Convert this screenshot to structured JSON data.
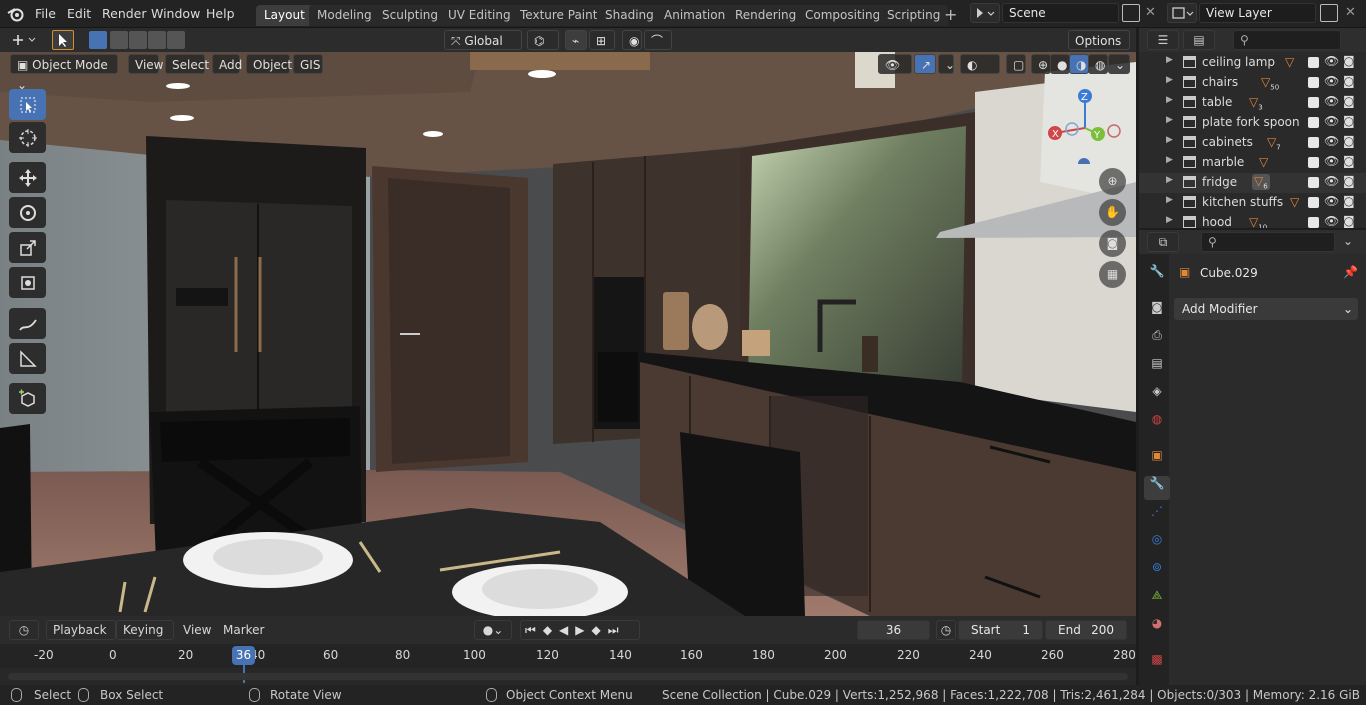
{
  "menus": [
    "File",
    "Edit",
    "Render",
    "Window",
    "Help"
  ],
  "workspaces": [
    "Layout",
    "Modeling",
    "Sculpting",
    "UV Editing",
    "Texture Paint",
    "Shading",
    "Animation",
    "Rendering",
    "Compositing",
    "Scripting"
  ],
  "active_workspace": "Layout",
  "scene_field": "Scene",
  "view_layer_field": "View Layer",
  "transform_orientation": "Global",
  "options_label": "Options",
  "viewport_header": {
    "mode": "Object Mode",
    "items": [
      "View",
      "Select",
      "Add",
      "Object",
      "GIS"
    ]
  },
  "gizmo": {
    "z": "Z",
    "y": "Y",
    "x": "X"
  },
  "outliner": {
    "items": [
      {
        "label": "ceiling lamp",
        "badge": ""
      },
      {
        "label": "chairs",
        "badge": "50"
      },
      {
        "label": "table",
        "badge": "3"
      },
      {
        "label": "plate fork spoon",
        "badge": ""
      },
      {
        "label": "cabinets",
        "badge": "7"
      },
      {
        "label": "marble",
        "badge": ""
      },
      {
        "label": "fridge",
        "badge": "6"
      },
      {
        "label": "kitchen stuffs",
        "badge": ""
      },
      {
        "label": "hood",
        "badge": "10"
      }
    ]
  },
  "properties": {
    "object_name": "Cube.029",
    "add_modifier": "Add Modifier"
  },
  "timeline": {
    "menus": [
      "Playback",
      "Keying",
      "View",
      "Marker"
    ],
    "current_frame": "36",
    "start_label": "Start",
    "start": "1",
    "end_label": "End",
    "end": "200",
    "ticks": [
      "-20",
      "0",
      "20",
      "40",
      "60",
      "80",
      "100",
      "120",
      "140",
      "160",
      "180",
      "200",
      "220",
      "240",
      "260",
      "280"
    ]
  },
  "statusbar": {
    "select": "Select",
    "box_select": "Box Select",
    "rotate_view": "Rotate View",
    "context_menu": "Object Context Menu",
    "stats": "Scene Collection | Cube.029 | Verts:1,252,968 | Faces:1,222,708 | Tris:2,461,284 | Objects:0/303 | Memory: 2.16 GiB"
  },
  "colors": {
    "accent_blue": "#4772b3",
    "header_bg": "#232323",
    "panel_bg": "#2b2b2b"
  }
}
